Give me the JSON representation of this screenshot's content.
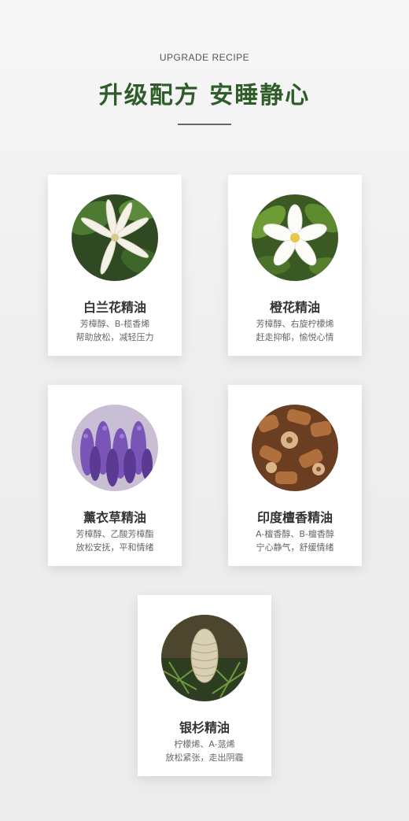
{
  "header": {
    "subtitle": "UPGRADE RECIPE",
    "title": "升级配方  安睡静心"
  },
  "cards": [
    {
      "name": "白兰花精油",
      "line1": "芳樟醇、B-榄香烯",
      "line2": "帮助放松，减轻压力",
      "icon": "white-magnolia-flower-icon"
    },
    {
      "name": "橙花精油",
      "line1": "芳樟醇、右旋柠檬烯",
      "line2": "赶走抑郁，愉悦心情",
      "icon": "orange-blossom-icon"
    },
    {
      "name": "薰衣草精油",
      "line1": "芳樟醇、乙酸芳樟酯",
      "line2": "放松安抚，平和情绪",
      "icon": "lavender-icon"
    },
    {
      "name": "印度檀香精油",
      "line1": "A-檀香醇、B-檀香醇",
      "line2": "宁心静气，舒缓情绪",
      "icon": "sandalwood-chips-icon"
    },
    {
      "name": "银杉精油",
      "line1": "柠檬烯、A-蒎烯",
      "line2": "放松紧张，走出阴霾",
      "icon": "silver-fir-cone-icon"
    }
  ]
}
